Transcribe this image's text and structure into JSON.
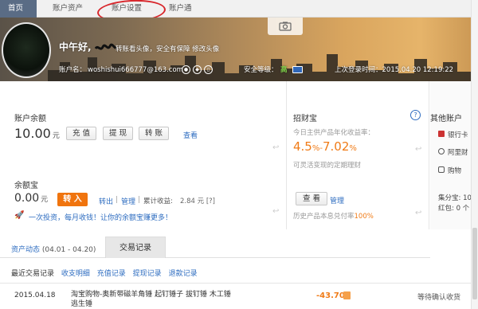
{
  "nav": {
    "tabs": [
      {
        "label": "首页",
        "active": true
      },
      {
        "label": "账户资产"
      },
      {
        "label": "账户设置"
      },
      {
        "label": "账户通"
      }
    ]
  },
  "banner": {
    "greeting": "中午好,",
    "greeting_sub": "转账看头像，安全有保障 修改头像",
    "account_label": "账户名：",
    "account_value": "woshishui666777@163.com",
    "security_label": "安全等级：",
    "security_value": "高",
    "last_login": "上次登录时间：2015.04.20 12:19:22"
  },
  "balance": {
    "title": "账户余额",
    "amount": "10.00",
    "unit": "元",
    "btn_recharge": "充 值",
    "btn_withdraw": "提 现",
    "btn_transfer": "转 账",
    "link_view": "查看"
  },
  "yuebao": {
    "title": "余额宝",
    "amount": "0.00",
    "unit": "元",
    "btn_in": "转 入",
    "link_out": "转出",
    "sep": "|",
    "link_manage": "管理",
    "accum_label": "累计收益:",
    "accum_value": "2.84 元 [?]",
    "promo": "一次投资，每月收钱！让你的余额宝赚更多！"
  },
  "zhaocaibao": {
    "title": "招财宝",
    "help": "?",
    "rate_label": "今日主供产品年化收益率：",
    "rate_low": "4.5",
    "rate_mid": "%-",
    "rate_high": "7.02",
    "rate_pct": "%",
    "desc": "可灵活变现的定期理财",
    "btn_view": "查 看",
    "link_manage": "管理",
    "history_prefix": "历史产品本息兑付率",
    "history_value": "100%"
  },
  "other_accounts": {
    "title": "其他账户",
    "items": [
      "银行卡",
      "阿里财",
      "购物"
    ],
    "jifen": "集分宝: 10",
    "hongbao": "红包: 0 个"
  },
  "tabs2": {
    "asset_label": "资产动态",
    "asset_date": "(04.01 - 04.20)",
    "trade_label": "交易记录"
  },
  "recent": {
    "title": "最近交易记录",
    "links": [
      "收支明细",
      "充值记录",
      "提现记录",
      "退款记录"
    ]
  },
  "transactions": [
    {
      "date": "2015.04.18",
      "desc": "淘宝购物-奥新带磁羊角锤 起钉锤子 拔钉锤 木工锤 逃生锤",
      "amount": "-43.70",
      "status": "等待确认收货"
    }
  ]
}
